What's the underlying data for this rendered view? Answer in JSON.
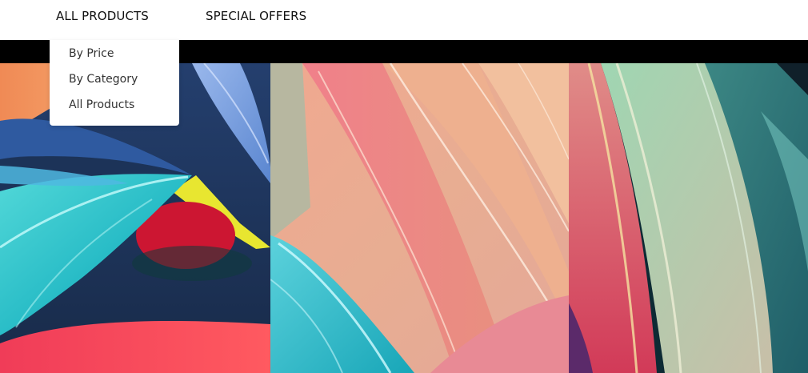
{
  "nav": {
    "items": [
      {
        "label": "ALL PRODUCTS"
      },
      {
        "label": "SPECIAL OFFERS"
      }
    ]
  },
  "dropdown": {
    "items": [
      {
        "label": "By Price"
      },
      {
        "label": "By Category"
      },
      {
        "label": "All Products"
      }
    ]
  },
  "hero": {
    "panels": [
      {
        "image": "abstract-tropical-leaves-teal-navy-red"
      },
      {
        "image": "abstract-leaves-peach-pink-teal"
      },
      {
        "image": "abstract-leaves-pink-green-teal"
      }
    ]
  },
  "colors": {
    "nav_bg": "#ffffff",
    "nav_text": "#111111",
    "strip": "#000000",
    "dropdown_text": "#333333"
  }
}
